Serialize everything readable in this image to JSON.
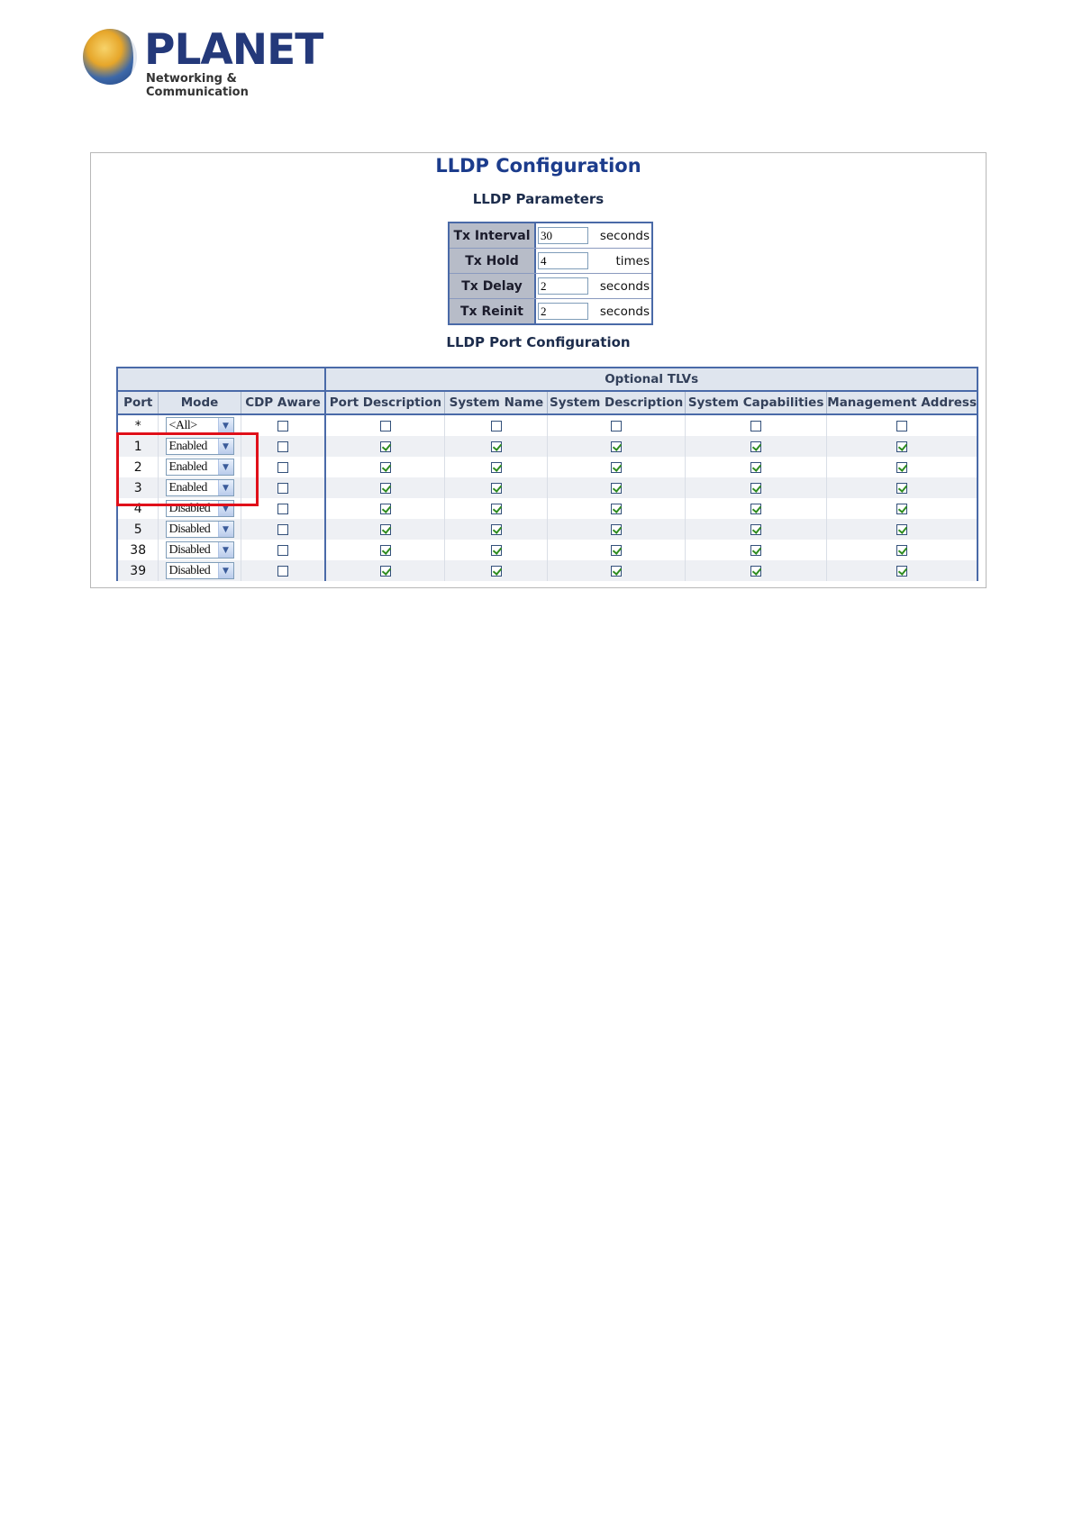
{
  "logo": {
    "brand": "PLANET",
    "tagline": "Networking & Communication"
  },
  "page": {
    "title": "LLDP Configuration",
    "params_heading": "LLDP Parameters",
    "ports_heading": "LLDP Port Configuration"
  },
  "params": [
    {
      "label": "Tx Interval",
      "value": "30",
      "unit": "seconds"
    },
    {
      "label": "Tx Hold",
      "value": "4",
      "unit": "times"
    },
    {
      "label": "Tx Delay",
      "value": "2",
      "unit": "seconds"
    },
    {
      "label": "Tx Reinit",
      "value": "2",
      "unit": "seconds"
    }
  ],
  "ports_table": {
    "group_header": "Optional TLVs",
    "columns": [
      "Port",
      "Mode",
      "CDP Aware",
      "Port Description",
      "System Name",
      "System Description",
      "System Capabilities",
      "Management Address"
    ],
    "rows": [
      {
        "port": "*",
        "mode": "<All>",
        "cdp": false,
        "tlvs": [
          false,
          false,
          false,
          false,
          false
        ]
      },
      {
        "port": "1",
        "mode": "Enabled",
        "cdp": false,
        "tlvs": [
          true,
          true,
          true,
          true,
          true
        ]
      },
      {
        "port": "2",
        "mode": "Enabled",
        "cdp": false,
        "tlvs": [
          true,
          true,
          true,
          true,
          true
        ]
      },
      {
        "port": "3",
        "mode": "Enabled",
        "cdp": false,
        "tlvs": [
          true,
          true,
          true,
          true,
          true
        ]
      },
      {
        "port": "4",
        "mode": "Disabled",
        "cdp": false,
        "tlvs": [
          true,
          true,
          true,
          true,
          true
        ]
      },
      {
        "port": "5",
        "mode": "Disabled",
        "cdp": false,
        "tlvs": [
          true,
          true,
          true,
          true,
          true
        ]
      },
      {
        "port": "38",
        "mode": "Disabled",
        "cdp": false,
        "tlvs": [
          true,
          true,
          true,
          true,
          true
        ]
      },
      {
        "port": "39",
        "mode": "Disabled",
        "cdp": false,
        "tlvs": [
          true,
          true,
          true,
          true,
          true
        ]
      }
    ]
  },
  "colors": {
    "highlight": "#e0101a",
    "title": "#1c3c8c",
    "table_border": "#4a6aa8"
  }
}
